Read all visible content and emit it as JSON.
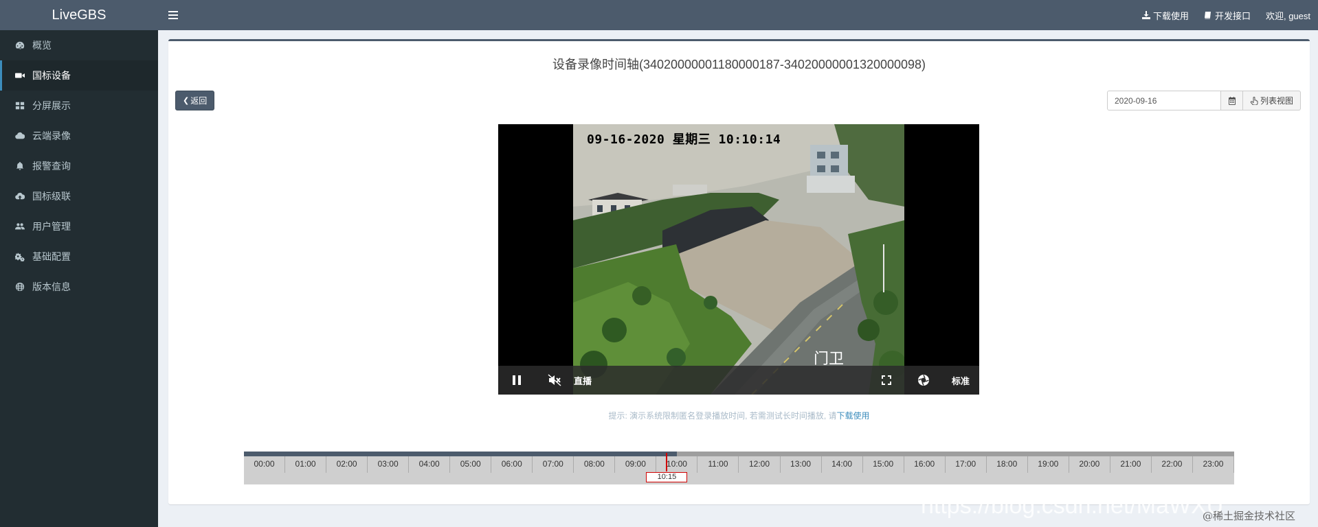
{
  "app": {
    "logo": "LiveGBS"
  },
  "sidebar": {
    "items": [
      {
        "label": "概览",
        "icon": "dashboard-icon",
        "active": false
      },
      {
        "label": "国标设备",
        "icon": "video-camera-icon",
        "active": true
      },
      {
        "label": "分屏展示",
        "icon": "grid-icon",
        "active": false
      },
      {
        "label": "云端录像",
        "icon": "cloud-icon",
        "active": false
      },
      {
        "label": "报警查询",
        "icon": "bell-icon",
        "active": false
      },
      {
        "label": "国标级联",
        "icon": "cloud-upload-icon",
        "active": false
      },
      {
        "label": "用户管理",
        "icon": "users-icon",
        "active": false
      },
      {
        "label": "基础配置",
        "icon": "gears-icon",
        "active": false
      },
      {
        "label": "版本信息",
        "icon": "globe-icon",
        "active": false
      }
    ]
  },
  "header": {
    "download_label": "下载使用",
    "api_label": "开发接口",
    "welcome_label": "欢迎, guest"
  },
  "main": {
    "title": "设备录像时间轴(34020000001180000187-34020000001320000098)",
    "back_label": "返回",
    "date_value": "2020-09-16",
    "list_view_label": "列表视图",
    "hint_text": "提示: 演示系统限制匿名登录播放时间, 若需测试长时间播放, 请",
    "hint_link": "下载使用"
  },
  "player": {
    "osd_time": "09-16-2020 星期三 10:10:14",
    "osd_name": "门卫",
    "live_label": "直播",
    "quality_label": "标准"
  },
  "timeline": {
    "hours": [
      "00:00",
      "01:00",
      "02:00",
      "03:00",
      "04:00",
      "05:00",
      "06:00",
      "07:00",
      "08:00",
      "09:00",
      "10:00",
      "11:00",
      "12:00",
      "13:00",
      "14:00",
      "15:00",
      "16:00",
      "17:00",
      "18:00",
      "19:00",
      "20:00",
      "21:00",
      "22:00",
      "23:00"
    ],
    "cursor_label": "10:15",
    "cursor_hours": 10.25,
    "recorded_until_hours": 10.5
  },
  "watermark": {
    "url_text": "https://blog.csdn.net/MaWXU",
    "community_text": "@稀土掘金技术社区"
  },
  "colors": {
    "sidebar_bg": "#222d32",
    "header_bg": "#4c5b6c",
    "accent": "#3c8dbc",
    "cursor": "#d10000"
  }
}
